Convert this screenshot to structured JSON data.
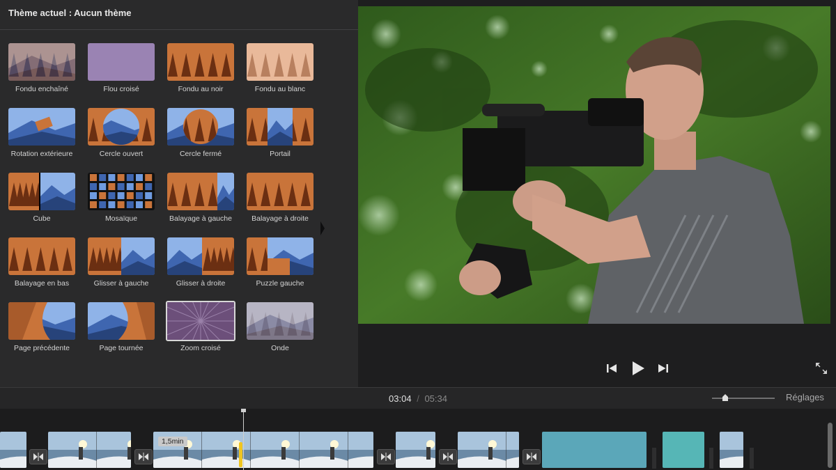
{
  "theme": {
    "title": "Thème actuel : Aucun thème"
  },
  "transitions": [
    {
      "label": "Fondu enchaîné",
      "style": "crossfade"
    },
    {
      "label": "Flou croisé",
      "style": "blur"
    },
    {
      "label": "Fondu au noir",
      "style": "forest"
    },
    {
      "label": "Fondu au blanc",
      "style": "forest-light"
    },
    {
      "label": "Rotation extérieure",
      "style": "spin"
    },
    {
      "label": "Cercle ouvert",
      "style": "circle-open"
    },
    {
      "label": "Cercle fermé",
      "style": "circle-close"
    },
    {
      "label": "Portail",
      "style": "portal"
    },
    {
      "label": "Cube",
      "style": "cube"
    },
    {
      "label": "Mosaïque",
      "style": "mosaic"
    },
    {
      "label": "Balayage à gauche",
      "style": "wipe-left"
    },
    {
      "label": "Balayage à droite",
      "style": "forest"
    },
    {
      "label": "Balayage en bas",
      "style": "forest"
    },
    {
      "label": "Glisser à gauche",
      "style": "slide-left"
    },
    {
      "label": "Glisser à droite",
      "style": "slide-right"
    },
    {
      "label": "Puzzle gauche",
      "style": "puzzle"
    },
    {
      "label": "Page précédente",
      "style": "page-curl"
    },
    {
      "label": "Page tournée",
      "style": "page-turn"
    },
    {
      "label": "Zoom croisé",
      "style": "zoom"
    },
    {
      "label": "Onde",
      "style": "ripple"
    }
  ],
  "selected_transition": "Zoom croisé",
  "viewer": {
    "controls": [
      "skip-back-icon",
      "play-icon",
      "skip-forward-icon",
      "fullscreen-icon"
    ]
  },
  "timeline": {
    "current_time": "03:04",
    "separator": "/",
    "total_time": "05:34",
    "settings_label": "Réglages",
    "duration_tag": "1,5min"
  },
  "colors": {
    "panel": "#2a2a2b",
    "accent_yellow": "#f0c520",
    "forest_orange": "#c9743a",
    "mountain_blue": "#3f66b0"
  }
}
